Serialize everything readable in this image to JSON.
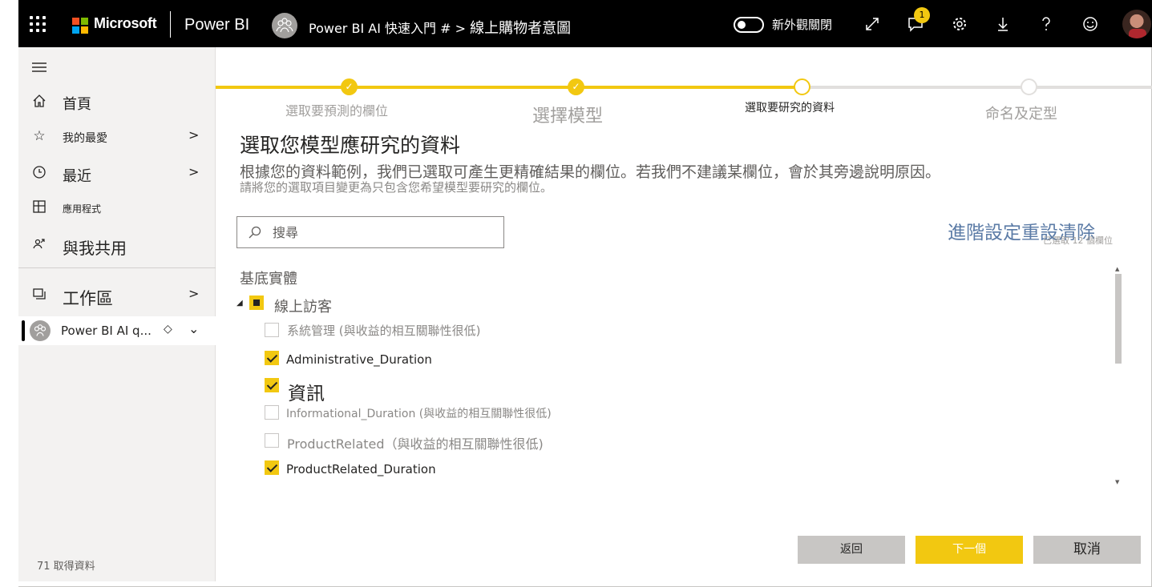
{
  "topbar": {
    "brand": "Microsoft",
    "product": "Power BI",
    "breadcrumb_workspace": "Power BI AI 快速入門 #",
    "breadcrumb_sep": ">",
    "breadcrumb_page": "線上購物者意圖",
    "toggle_label": "新外觀關閉",
    "notification_count": "1",
    "icons": [
      "app-launcher-icon",
      "expand-icon",
      "notification-icon",
      "settings-icon",
      "download-icon",
      "help-icon",
      "feedback-smiley-icon",
      "user-avatar"
    ]
  },
  "sidebar": {
    "items": [
      {
        "label": "首頁",
        "icon": "home-icon"
      },
      {
        "label": "我的最愛",
        "icon": "star-icon",
        "chevron": ">"
      },
      {
        "label": "最近",
        "icon": "clock-icon",
        "chevron": ">"
      },
      {
        "label": "應用程式",
        "icon": "apps-icon"
      },
      {
        "label": "與我共用",
        "icon": "shared-icon"
      },
      {
        "label": "工作區",
        "icon": "workspaces-icon",
        "chevron": ">"
      }
    ],
    "active_workspace": {
      "label": "Power BI AI q...",
      "gem": "◇",
      "chevron": "⌄"
    },
    "get_data": "71 取得資料"
  },
  "stepper": {
    "steps": [
      {
        "label": "選取要預測的欄位",
        "state": "done"
      },
      {
        "label": "選擇模型",
        "state": "done"
      },
      {
        "label": "選取要研究的資料",
        "state": "current"
      },
      {
        "label": "命名及定型",
        "state": "todo"
      }
    ],
    "colors": {
      "accent": "#f2c811",
      "inactive": "#e1dfdd"
    }
  },
  "main": {
    "title": "選取您模型應研究的資料",
    "description": "根據您的資料範例，我們已選取可產生更精確結果的欄位。若我們不建議某欄位，會於其旁邊說明原因。",
    "description_sub": "請將您的選取項目變更為只包含您希望模型要研究的欄位。",
    "search_placeholder": "搜尋",
    "advanced_link": "進階設定重設清除",
    "selected_count": "已選取 12 個欄位",
    "entities_label": "基底實體",
    "entity": {
      "name": "線上訪客",
      "expanded": "◢",
      "state": "partial"
    },
    "fields": [
      {
        "label": "系統管理 (與收益的相互關聯性很低)",
        "checked": false
      },
      {
        "label": "Administrative_Duration",
        "checked": true
      },
      {
        "label": "資訊",
        "checked": true
      },
      {
        "label": "Informational_Duration (與收益的相互關聯性很低)",
        "checked": false
      },
      {
        "label": "ProductRelated（與收益的相互關聯性很低)",
        "checked": false
      },
      {
        "label": "ProductRelated_Duration",
        "checked": true
      }
    ]
  },
  "footer": {
    "back": "返回",
    "next": "下一個",
    "cancel": "取消"
  }
}
